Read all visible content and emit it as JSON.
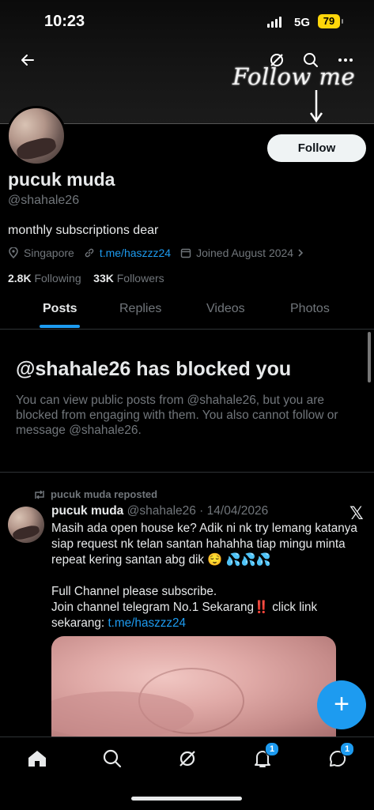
{
  "status": {
    "time": "10:23",
    "network": "5G",
    "battery": "79"
  },
  "banner": {
    "overlay_text": "Follow me"
  },
  "header_icons": [
    "back-arrow-icon",
    "grok-icon",
    "search-icon",
    "more-icon"
  ],
  "profile": {
    "name": "pucuk muda",
    "handle": "@shahale26",
    "bio": "monthly subscriptions dear",
    "location": "Singapore",
    "link": "t.me/haszzz24",
    "joined": "Joined August 2024",
    "following_count": "2.8K",
    "following_label": "Following",
    "followers_count": "33K",
    "followers_label": "Followers",
    "follow_label": "Follow"
  },
  "tabs": [
    "Posts",
    "Replies",
    "Videos",
    "Photos"
  ],
  "blocked": {
    "title": "@shahale26 has blocked you",
    "description": "You can view public posts from @shahale26, but you are blocked from engaging with them. You also cannot follow or message @shahale26."
  },
  "post": {
    "repost_label": "pucuk muda reposted",
    "author_name": "pucuk muda",
    "author_handle_date": "@shahale26 · 14/04/2026",
    "line1": "Masih ada open house ke? Adik ni nk try lemang katanya siap request nk telan santan hahahha tiap mingu minta repeat kering santan abg dik",
    "emoji": "😌",
    "drops": "💦💦💦",
    "line2": "Full Channel please subscribe.",
    "line3": "Join channel telegram No.1 Sekarang",
    "bang": "‼️",
    "line3b": " click link sekarang: ",
    "link": "t.me/haszzz24"
  },
  "nav": {
    "notifications_badge": "1",
    "messages_badge": "1"
  },
  "colors": {
    "accent": "#1d9bf0",
    "muted": "#71767b",
    "text": "#e7e9ea"
  }
}
